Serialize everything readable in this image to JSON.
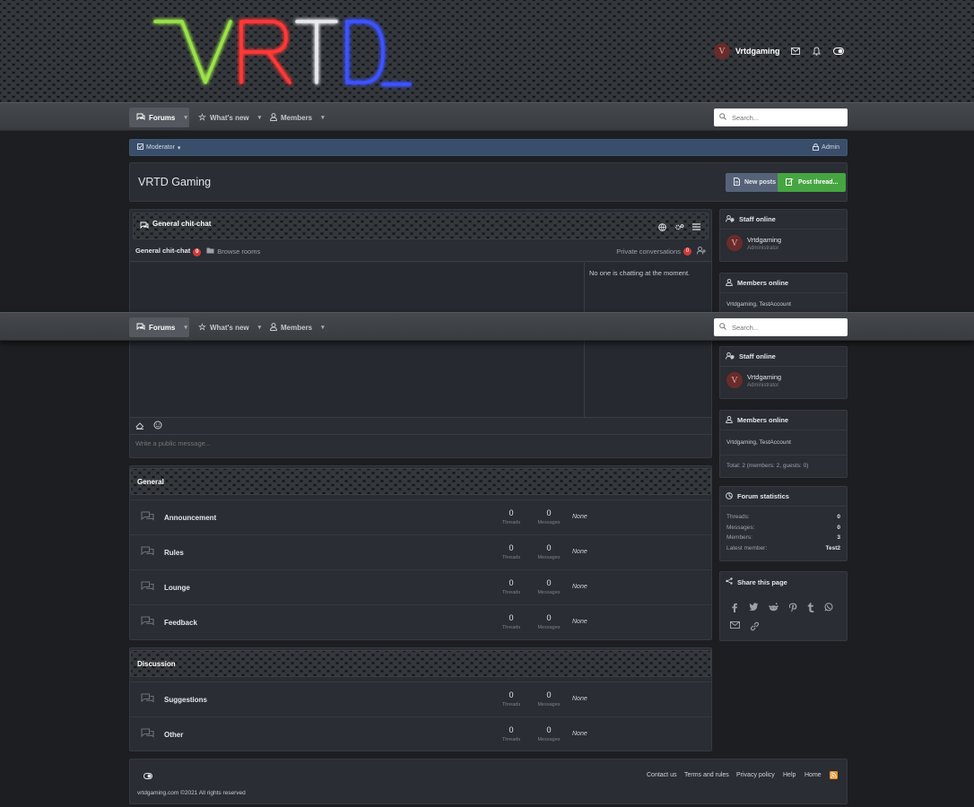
{
  "header": {
    "logo_text": "VRTD",
    "username": "Vrtdgaming",
    "avatar_letter": "V"
  },
  "nav": {
    "tabs": [
      {
        "label": "Forums",
        "active": true
      },
      {
        "label": "What's new",
        "active": false
      },
      {
        "label": "Members",
        "active": false
      }
    ],
    "search_placeholder": "Search..."
  },
  "modbar": {
    "moderator": "Moderator",
    "admin": "Admin"
  },
  "page": {
    "title": "VRTD Gaming",
    "new_posts": "New posts",
    "post_thread": "Post thread..."
  },
  "chat": {
    "title": "General chit-chat",
    "room": "General chit-chat",
    "room_count": "0",
    "browse_rooms": "Browse rooms",
    "private_conversations": "Private conversations",
    "private_count": "0",
    "notice": "No one is chatting at the moment.",
    "placeholder": "Write a public message..."
  },
  "categories": [
    {
      "title": "General",
      "forums": [
        {
          "name": "Announcement",
          "threads": "0",
          "messages": "0",
          "last": "None"
        },
        {
          "name": "Rules",
          "threads": "0",
          "messages": "0",
          "last": "None"
        },
        {
          "name": "Lounge",
          "threads": "0",
          "messages": "0",
          "last": "None"
        },
        {
          "name": "Feedback",
          "threads": "0",
          "messages": "0",
          "last": "None"
        }
      ]
    },
    {
      "title": "Discussion",
      "forums": [
        {
          "name": "Suggestions",
          "threads": "0",
          "messages": "0",
          "last": "None"
        },
        {
          "name": "Other",
          "threads": "0",
          "messages": "0",
          "last": "None"
        }
      ]
    }
  ],
  "labels": {
    "threads": "Threads",
    "messages": "Messages"
  },
  "sidebar": {
    "staff_title": "Staff online",
    "staff_name": "Vrtdgaming",
    "staff_role": "Administrator",
    "members_title": "Members online",
    "members_list": "Vrtdgaming, TestAccount",
    "members_total": "Total: 2 (members: 2, guests: 0)",
    "stats_title": "Forum statistics",
    "stats": [
      {
        "label": "Threads:",
        "value": "0"
      },
      {
        "label": "Messages:",
        "value": "0"
      },
      {
        "label": "Members:",
        "value": "3"
      },
      {
        "label": "Latest member:",
        "value": "Test2"
      }
    ],
    "share_title": "Share this page"
  },
  "footer": {
    "links": [
      "Contact us",
      "Terms and rules",
      "Privacy policy",
      "Help",
      "Home"
    ],
    "copyright": "vrtdgaming.com ©2021 All rights reserved"
  },
  "colors": {
    "accent_green": "#46a541",
    "mod_bar": "#394e6a",
    "badge_red": "#d03a3a"
  }
}
